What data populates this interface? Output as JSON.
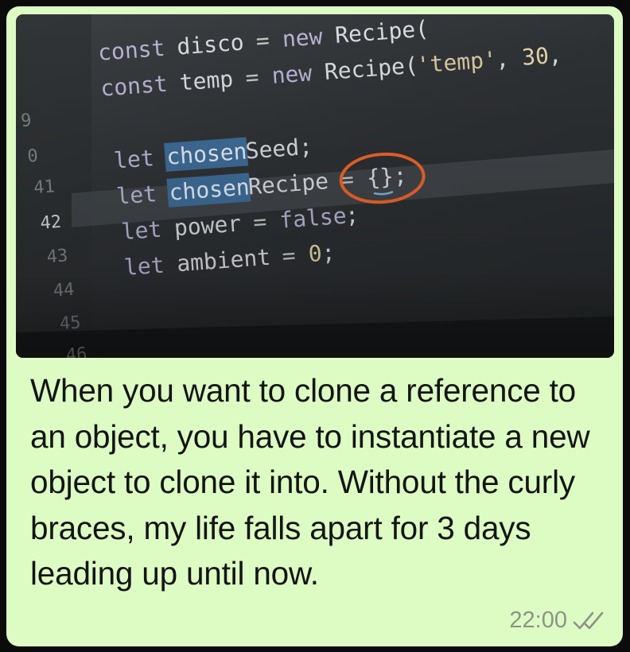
{
  "message": {
    "image": {
      "line_numbers": [
        "9",
        "0",
        "41",
        "42",
        "43",
        "44",
        "45",
        "46"
      ],
      "code_lines": [
        {
          "num": "",
          "parts": [
            [
              "kw",
              "const "
            ],
            [
              "id",
              "disco "
            ],
            [
              "op",
              "= "
            ],
            [
              "kw",
              "new "
            ],
            [
              "id",
              "Recipe("
            ]
          ]
        },
        {
          "num": "",
          "parts": [
            [
              "kw",
              "const "
            ],
            [
              "id",
              "temp "
            ],
            [
              "op",
              "= "
            ],
            [
              "kw",
              "new "
            ],
            [
              "id",
              "Recipe("
            ],
            [
              "str",
              "'temp'"
            ],
            [
              "id",
              ", "
            ],
            [
              "num",
              "30"
            ],
            [
              "id",
              ","
            ]
          ]
        },
        {
          "num": "",
          "parts": []
        },
        {
          "num": "",
          "parts": [
            [
              "kw",
              "let "
            ],
            [
              "hl",
              "chosen"
            ],
            [
              "id",
              "Seed;"
            ]
          ]
        },
        {
          "num": "",
          "parts": [
            [
              "kw",
              "let "
            ],
            [
              "hl",
              "chosen"
            ],
            [
              "id",
              "Recipe "
            ],
            [
              "op",
              "= "
            ],
            [
              "id",
              "{};"
            ]
          ]
        },
        {
          "num": "",
          "parts": [
            [
              "kw",
              "let "
            ],
            [
              "id",
              "power "
            ],
            [
              "op",
              "= "
            ],
            [
              "kw",
              "false"
            ],
            [
              "id",
              ";"
            ]
          ]
        },
        {
          "num": "",
          "parts": [
            [
              "kw",
              "let "
            ],
            [
              "id",
              "ambient "
            ],
            [
              "op",
              "= "
            ],
            [
              "num",
              "0"
            ],
            [
              "id",
              ";"
            ]
          ]
        }
      ],
      "stray_text": "/*"
    },
    "caption": "When you want to clone a reference to an object, you have to instantiate a new object to clone it into. Without the curly braces, my life falls apart for 3 days leading up until now.",
    "time": "22:00",
    "status_icon": "double-check-icon",
    "colors": {
      "bubble": "#ddfcc4",
      "time": "#8c9486",
      "annotation_circle": "#f0652a",
      "highlight": "#3f6d99"
    }
  }
}
